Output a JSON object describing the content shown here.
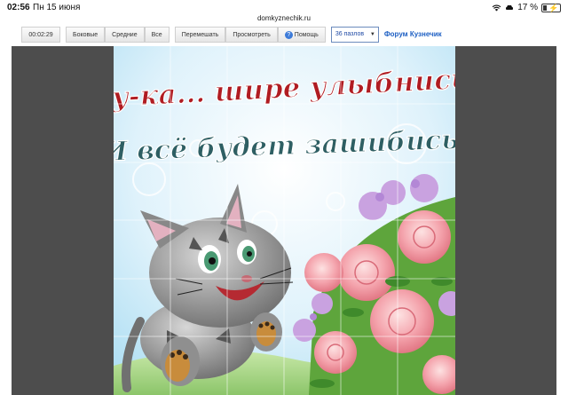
{
  "status_bar": {
    "time": "02:56",
    "date": "Пн 15 июня",
    "url": "domkyznechik.ru",
    "battery": "17 %"
  },
  "toolbar": {
    "timer": "00:02:29",
    "sides_label": "Боковые",
    "middle_label": "Средние",
    "all_label": "Все",
    "shuffle_label": "Перемешать",
    "preview_label": "Просмотреть",
    "help_label": "Помощь",
    "pieces_select": "36 пазлов",
    "forum_link": "Форум Кузнечик"
  },
  "puzzle": {
    "line1": "Ну-ка... шире улыбнись!",
    "line2": "И всё будет зашибись!"
  },
  "colors": {
    "accent": "#1d5fc3",
    "board": "#4d4d4d",
    "title_red": "#b01c22"
  }
}
